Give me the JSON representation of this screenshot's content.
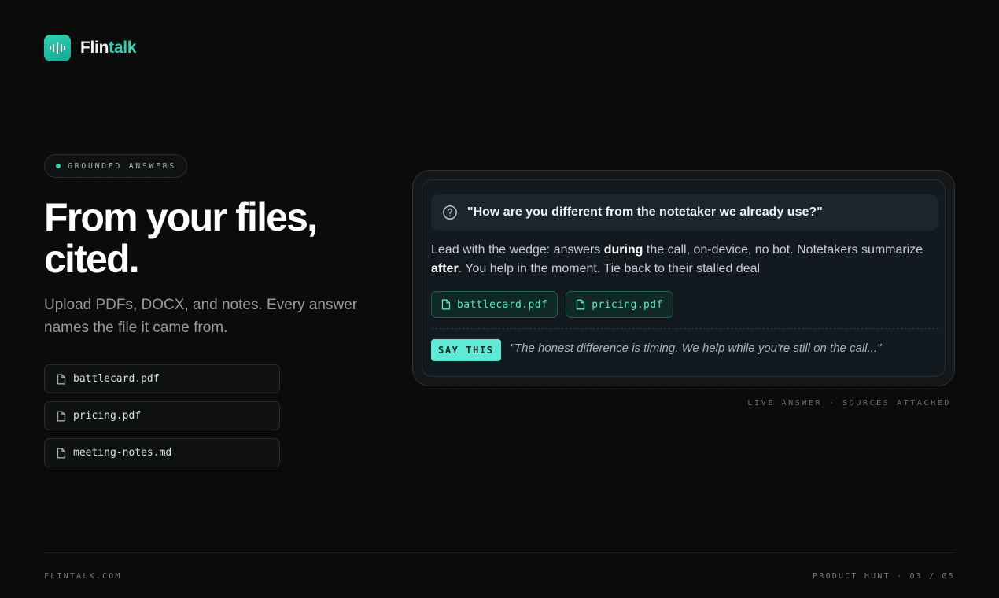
{
  "brand": {
    "name_part1": "Flin",
    "name_part2": "talk",
    "accent_color": "#2fd3b6",
    "logo_icon": "waveform-icon"
  },
  "badge": {
    "label": "GROUNDED ANSWERS"
  },
  "hero": {
    "title_line1": "From your files,",
    "title_line2": "cited.",
    "subtitle": "Upload PDFs, DOCX, and notes. Every answer names the file it came from."
  },
  "files": [
    {
      "name": "battlecard.pdf",
      "icon": "file-icon"
    },
    {
      "name": "pricing.pdf",
      "icon": "file-icon"
    },
    {
      "name": "meeting-notes.md",
      "icon": "file-icon"
    }
  ],
  "card": {
    "question_icon": "question-circle-icon",
    "question": "\"How are you different from the notetaker we already use?\"",
    "answer": {
      "part1": "Lead with the wedge: answers ",
      "bold1": "during",
      "part2": " the call, on-device, no bot. Notetakers summarize ",
      "bold2": "after",
      "part3": ". You help in the moment. Tie back to their stalled deal"
    },
    "sources": [
      {
        "name": "battlecard.pdf",
        "icon": "file-icon"
      },
      {
        "name": "pricing.pdf",
        "icon": "file-icon"
      }
    ],
    "say_label": "SAY THIS",
    "say_quote": "\"The honest difference is timing. We help while you're still on the call...\""
  },
  "card_caption": "LIVE ANSWER · SOURCES ATTACHED",
  "footer": {
    "left": "FLINTALK.COM",
    "right": "PRODUCT HUNT · 03 / 05"
  }
}
